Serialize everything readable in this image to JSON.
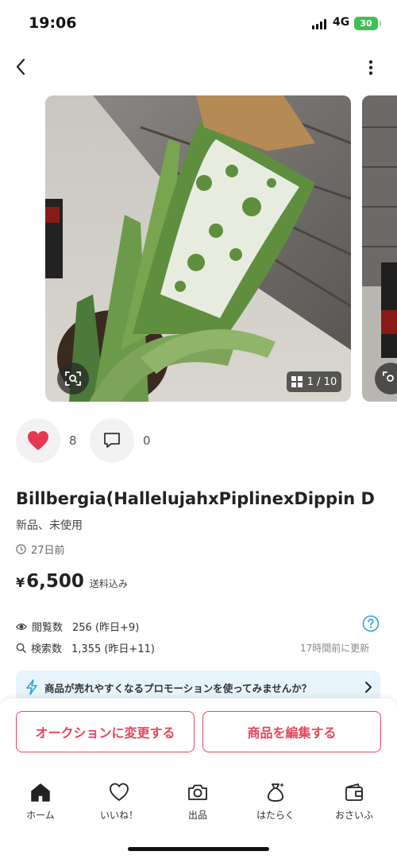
{
  "status_bar": {
    "time": "19:06",
    "network": "4G",
    "battery": "30"
  },
  "gallery": {
    "counter": "1 / 10"
  },
  "engagement": {
    "likes": "8",
    "comments": "0"
  },
  "item": {
    "title": "Billbergia(HallelujahxPiplinexDippin D",
    "condition": "新品、未使用",
    "posted": "27日前",
    "price_symbol": "¥",
    "price": "6,500",
    "shipping": "送料込み"
  },
  "stats": {
    "views_label": "閲覧数",
    "views_value": "256 (昨日+9)",
    "search_label": "検索数",
    "search_value": "1,355 (昨日+11)",
    "updated": "17時間前に更新"
  },
  "promo": {
    "text": "商品が売れやすくなるプロモーションを使ってみませんか？"
  },
  "actions": {
    "auction": "オークションに変更する",
    "edit": "商品を編集する"
  },
  "tabs": [
    {
      "label": "ホーム",
      "icon": "home-icon"
    },
    {
      "label": "いいね！",
      "icon": "heart-outline-icon"
    },
    {
      "label": "出品",
      "icon": "camera-icon"
    },
    {
      "label": "はたらく",
      "icon": "money-bag-icon"
    },
    {
      "label": "おさいふ",
      "icon": "wallet-icon"
    }
  ],
  "colors": {
    "accent": "#e8455a",
    "heart": "#e8384f",
    "promo_bg": "#e8f4fb",
    "help": "#2aa3d8"
  }
}
